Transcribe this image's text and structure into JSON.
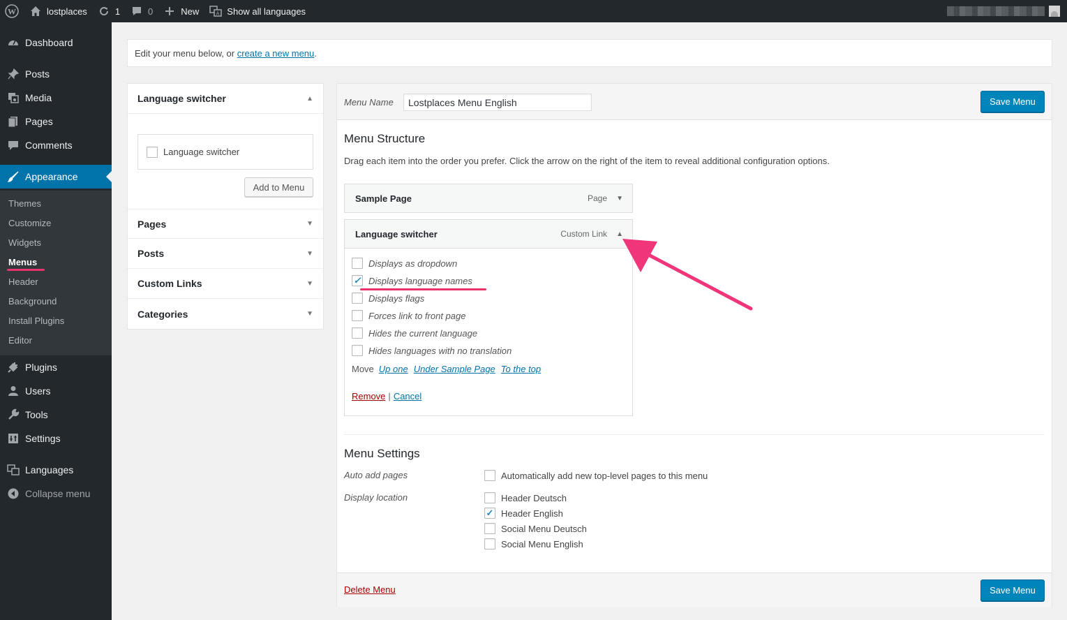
{
  "adminbar": {
    "site_name": "lostplaces",
    "updates_count": "1",
    "comments_count": "0",
    "new_label": "New",
    "languages_label": "Show all languages"
  },
  "sidebar": {
    "items": [
      {
        "label": "Dashboard",
        "icon": "dashboard-icon"
      },
      {
        "label": "Posts",
        "icon": "pin-icon"
      },
      {
        "label": "Media",
        "icon": "media-icon"
      },
      {
        "label": "Pages",
        "icon": "pages-icon"
      },
      {
        "label": "Comments",
        "icon": "comment-icon"
      },
      {
        "label": "Appearance",
        "icon": "brush-icon"
      },
      {
        "label": "Plugins",
        "icon": "plugin-icon"
      },
      {
        "label": "Users",
        "icon": "user-icon"
      },
      {
        "label": "Tools",
        "icon": "wrench-icon"
      },
      {
        "label": "Settings",
        "icon": "settings-icon"
      },
      {
        "label": "Languages",
        "icon": "translate-icon"
      },
      {
        "label": "Collapse menu",
        "icon": "collapse-icon"
      }
    ],
    "submenu": [
      "Themes",
      "Customize",
      "Widgets",
      "Menus",
      "Header",
      "Background",
      "Install Plugins",
      "Editor"
    ],
    "active_item": "Appearance",
    "active_submenu": "Menus"
  },
  "notice": {
    "text": "Edit your menu below, or ",
    "link": "create a new menu",
    "suffix": "."
  },
  "left_panels": {
    "language_switcher": {
      "title": "Language switcher",
      "checkbox_label": "Language switcher",
      "add_button": "Add to Menu"
    },
    "sections": [
      "Pages",
      "Posts",
      "Custom Links",
      "Categories"
    ]
  },
  "menu": {
    "name_label": "Menu Name",
    "name_value": "Lostplaces Menu English",
    "save_label": "Save Menu",
    "structure_title": "Menu Structure",
    "structure_desc": "Drag each item into the order you prefer. Click the arrow on the right of the item to reveal additional configuration options.",
    "items": [
      {
        "title": "Sample Page",
        "type": "Page"
      },
      {
        "title": "Language switcher",
        "type": "Custom Link"
      }
    ],
    "switcher_options": [
      {
        "label": "Displays as dropdown",
        "checked": false
      },
      {
        "label": "Displays language names",
        "checked": true
      },
      {
        "label": "Displays flags",
        "checked": false
      },
      {
        "label": "Forces link to front page",
        "checked": false
      },
      {
        "label": "Hides the current language",
        "checked": false
      },
      {
        "label": "Hides languages with no translation",
        "checked": false
      }
    ],
    "move_label": "Move",
    "move_links": [
      "Up one",
      "Under Sample Page",
      "To the top"
    ],
    "remove_label": "Remove",
    "separator": "|",
    "cancel_label": "Cancel",
    "settings_title": "Menu Settings",
    "auto_add_label": "Auto add pages",
    "auto_add_option": "Automatically add new top-level pages to this menu",
    "display_location_label": "Display location",
    "locations": [
      {
        "label": "Header Deutsch",
        "checked": false
      },
      {
        "label": "Header English",
        "checked": true
      },
      {
        "label": "Social Menu Deutsch",
        "checked": false
      },
      {
        "label": "Social Menu English",
        "checked": false
      }
    ],
    "delete_label": "Delete Menu"
  },
  "colors": {
    "accent": "#0073aa",
    "highlight": "#e8336d",
    "admin_bg": "#23282d"
  }
}
